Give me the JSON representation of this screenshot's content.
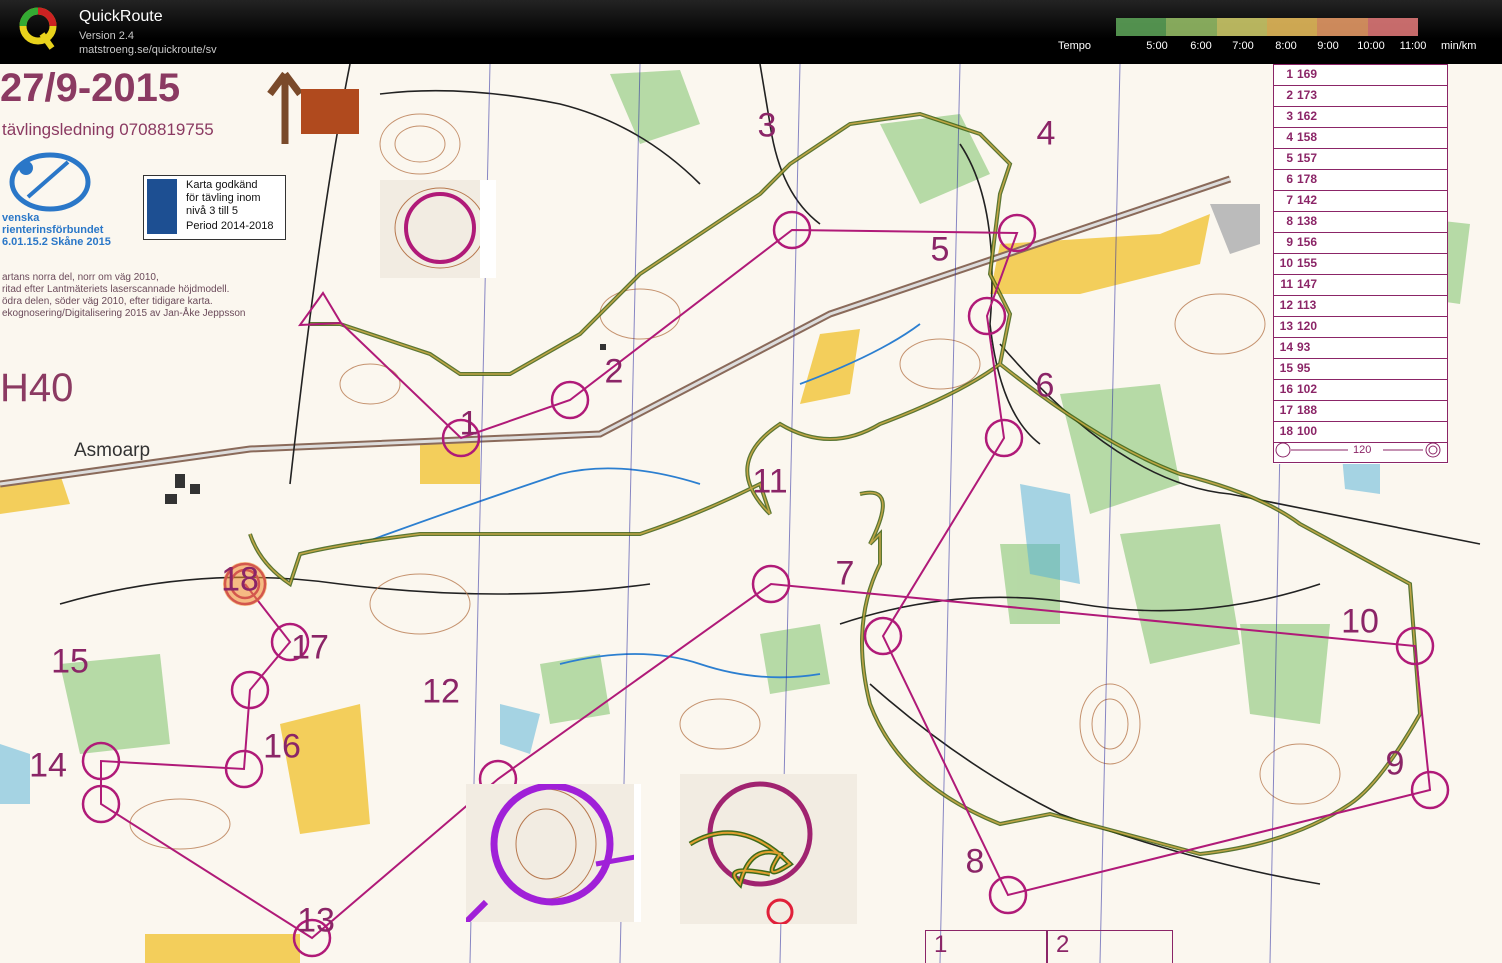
{
  "app": {
    "title": "QuickRoute",
    "version": "Version 2.4",
    "url": "matstroeng.se/quickroute/sv"
  },
  "tempo": {
    "label": "Tempo",
    "ticks": [
      "5:00",
      "6:00",
      "7:00",
      "8:00",
      "9:00",
      "10:00",
      "11:00"
    ],
    "unit": "min/km",
    "colors": [
      "#5fa85a",
      "#9bc46a",
      "#d6d26d",
      "#f0c35f",
      "#eea06a",
      "#e77d7d"
    ]
  },
  "map": {
    "date": "27/9-2015",
    "phone": "tävlingsledning 0708819755",
    "org_lines": [
      "venska",
      "rienterinsförbundet",
      "6.01.15.2 Skåne 2015"
    ],
    "approval_lines": [
      "Karta godkänd",
      "för tävling inom",
      "nivå 3 till 5"
    ],
    "approval_period": "Period 2014-2018",
    "info_lines": [
      "artans norra del, norr om väg 2010,",
      "ritad efter Lantmäteriets laserscannade höjdmodell.",
      "ödra delen, söder väg 2010, efter tidigare karta.",
      "ekognosering/Digitalisering 2015 av Jan-Åke Jeppsson"
    ],
    "class": "H40",
    "place": "Asmoarp",
    "controls": [
      {
        "n": "1"
      },
      {
        "n": "2"
      },
      {
        "n": "3"
      },
      {
        "n": "4"
      },
      {
        "n": "5"
      },
      {
        "n": "6"
      },
      {
        "n": "7"
      },
      {
        "n": "8"
      },
      {
        "n": "9"
      },
      {
        "n": "10"
      },
      {
        "n": "11"
      },
      {
        "n": "12"
      },
      {
        "n": "13"
      },
      {
        "n": "14"
      },
      {
        "n": "15"
      },
      {
        "n": "16"
      },
      {
        "n": "17"
      },
      {
        "n": "18"
      }
    ],
    "descriptions": [
      {
        "no": "1",
        "code": "169"
      },
      {
        "no": "2",
        "code": "173"
      },
      {
        "no": "3",
        "code": "162"
      },
      {
        "no": "4",
        "code": "158"
      },
      {
        "no": "5",
        "code": "157"
      },
      {
        "no": "6",
        "code": "178"
      },
      {
        "no": "7",
        "code": "142"
      },
      {
        "no": "8",
        "code": "138"
      },
      {
        "no": "9",
        "code": "156"
      },
      {
        "no": "10",
        "code": "155"
      },
      {
        "no": "11",
        "code": "147"
      },
      {
        "no": "12",
        "code": "113"
      },
      {
        "no": "13",
        "code": "120"
      },
      {
        "no": "14",
        "code": "93"
      },
      {
        "no": "15",
        "code": "95"
      },
      {
        "no": "16",
        "code": "102"
      },
      {
        "no": "17",
        "code": "188"
      },
      {
        "no": "18",
        "code": "100"
      }
    ],
    "finish_distance": "120",
    "page_boxes": [
      "1",
      "2"
    ]
  }
}
